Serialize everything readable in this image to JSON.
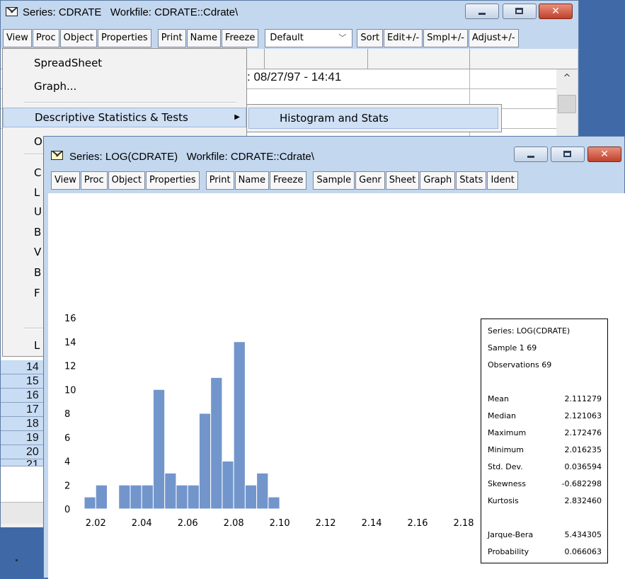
{
  "window_back": {
    "title": "Series: CDRATE   Workfile: CDRATE::Cdrate\\",
    "toolbar": [
      "View",
      "Proc",
      "Object",
      "Properties",
      "Print",
      "Name",
      "Freeze"
    ],
    "display_select": "Default",
    "toolbar_right": [
      "Sort",
      "Edit+/-",
      "Smpl+/-",
      "Adjust+/-"
    ],
    "date_text": ": 08/27/97 - 14:41",
    "row_labels": [
      "14",
      "15",
      "16",
      "17",
      "18",
      "19",
      "20",
      "21"
    ]
  },
  "view_menu": {
    "items": [
      "SpreadSheet",
      "Graph...",
      "Descriptive Statistics & Tests",
      "O",
      "C",
      "L",
      "U",
      "B",
      "V",
      "B",
      "F",
      "L"
    ],
    "submenu": "Histogram and Stats"
  },
  "window_front": {
    "title": "Series: LOG(CDRATE)   Workfile: CDRATE::Cdrate\\",
    "toolbar": [
      "View",
      "Proc",
      "Object",
      "Properties",
      "Print",
      "Name",
      "Freeze",
      "Sample",
      "Genr",
      "Sheet",
      "Graph",
      "Stats",
      "Ident"
    ]
  },
  "chart_data": {
    "type": "bar",
    "title": "",
    "xlabel": "",
    "ylabel": "",
    "bin_width": 0.005,
    "bin_start": 2.015,
    "values": [
      1,
      2,
      0,
      2,
      2,
      2,
      10,
      3,
      2,
      2,
      8,
      11,
      4,
      14,
      2,
      3,
      1
    ],
    "xticks": [
      "2.02",
      "2.04",
      "2.06",
      "2.08",
      "2.10",
      "2.12",
      "2.14",
      "2.16",
      "2.18"
    ],
    "xlim": [
      2.015,
      2.18
    ],
    "yticks": [
      "0",
      "2",
      "4",
      "6",
      "8",
      "10",
      "12",
      "14",
      "16"
    ],
    "ylim": [
      0,
      16
    ],
    "bar_color": "#7295cc",
    "grid": false
  },
  "stats": {
    "series": "Series: LOG(CDRATE)",
    "sample": "Sample 1 69",
    "observations": "Observations 69",
    "rows": [
      {
        "label": "Mean",
        "value": "2.111279"
      },
      {
        "label": "Median",
        "value": "2.121063"
      },
      {
        "label": "Maximum",
        "value": "2.172476"
      },
      {
        "label": "Minimum",
        "value": "2.016235"
      },
      {
        "label": "Std. Dev.",
        "value": "0.036594"
      },
      {
        "label": "Skewness",
        "value": "-0.682298"
      },
      {
        "label": "Kurtosis",
        "value": "2.832460"
      }
    ],
    "tests": [
      {
        "label": "Jarque-Bera",
        "value": "5.434305"
      },
      {
        "label": "Probability",
        "value": "0.066063"
      }
    ]
  }
}
